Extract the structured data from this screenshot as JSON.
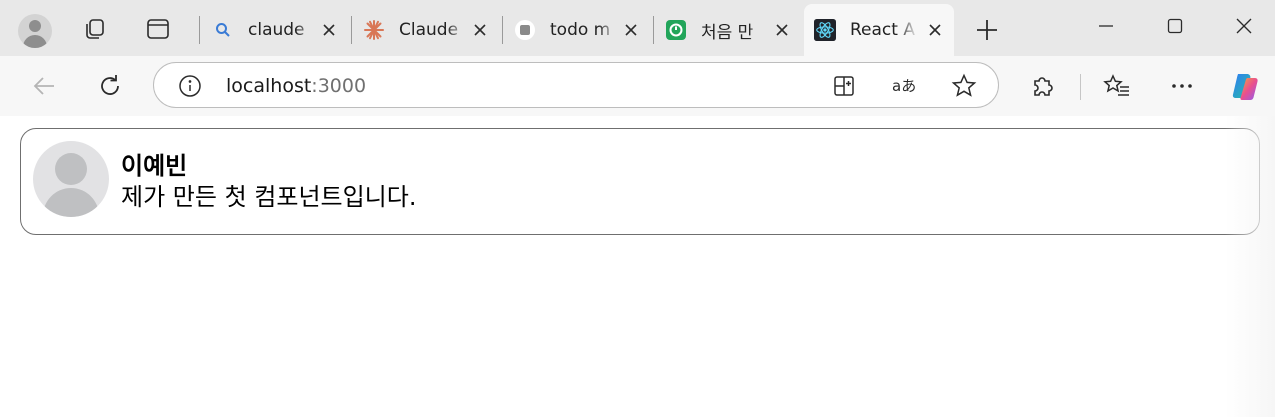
{
  "browser": {
    "tabs": [
      {
        "title": "claude",
        "favicon": "search-icon",
        "active": false
      },
      {
        "title": "Claude",
        "favicon": "claude-logo-icon",
        "active": false
      },
      {
        "title": "todo m",
        "favicon": "notion-logo-icon",
        "active": false
      },
      {
        "title": "처음 만",
        "favicon": "green-app-icon",
        "active": false
      },
      {
        "title": "React A",
        "favicon": "react-logo-icon",
        "active": true
      }
    ],
    "address": {
      "host": "localhost",
      "port": ":3000"
    }
  },
  "profile_card": {
    "name": "이예빈",
    "description": "제가 만든 첫 컴포넌트입니다."
  },
  "colors": {
    "tabstrip_bg": "#e8e8e8",
    "toolbar_bg": "#f7f7f7",
    "claude_orange": "#d97757",
    "notion_gray": "#8a8a8a",
    "green_app": "#22a55a",
    "react_blue": "#61dafb",
    "card_border": "#6f6f6f"
  }
}
